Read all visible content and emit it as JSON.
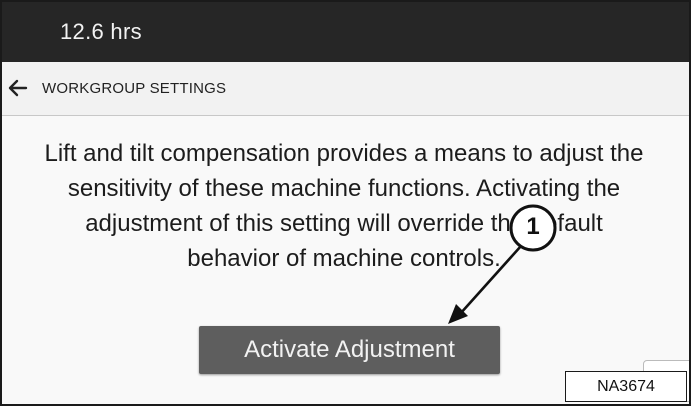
{
  "status_bar": {
    "hours": "12.6 hrs"
  },
  "nav": {
    "back_icon": "arrow-left-icon",
    "title": "WORKGROUP SETTINGS"
  },
  "content": {
    "message": "Lift and tilt compensation provides a means to adjust the sensitivity of these machine functions. Activating the adjustment of this setting will override the default behavior of machine controls.",
    "activate_label": "Activate Adjustment"
  },
  "callout": {
    "number": "1"
  },
  "figure_id": "NA3674",
  "colors": {
    "status_bar": "#262626",
    "button": "#5e5e5e"
  }
}
